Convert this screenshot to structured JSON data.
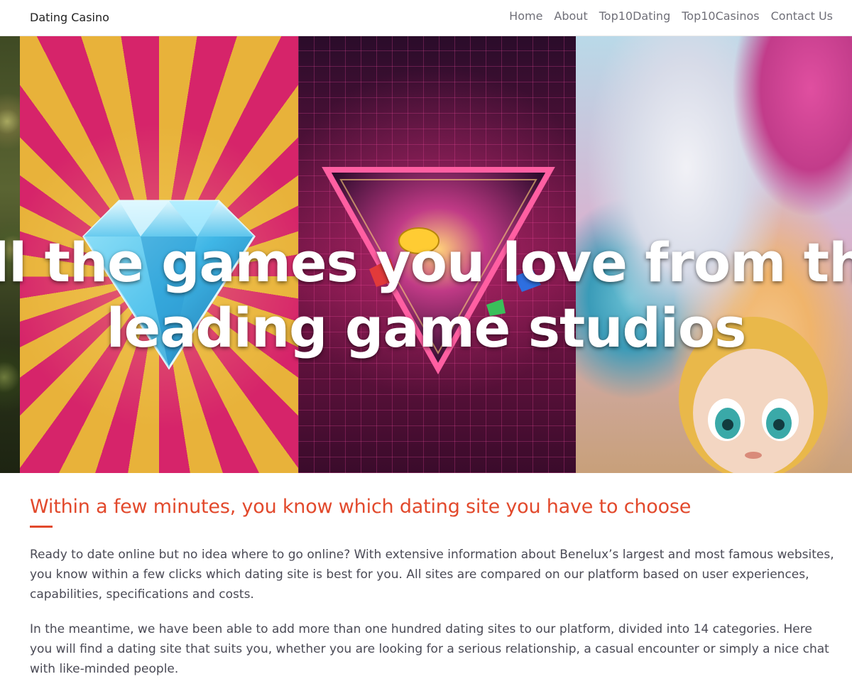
{
  "navbar": {
    "brand": "Dating Casino",
    "links": [
      "Home",
      "About",
      "Top10Dating",
      "Top10Casinos",
      "Contact Us"
    ]
  },
  "hero": {
    "title_line_1": "All the games you love from the",
    "title_line_2": "leading game studios",
    "tiles": [
      "jungle-slot-tile",
      "diamond-sunburst-slot-tile",
      "neon-gem-triangle-slot-tile",
      "candy-doll-slot-tile"
    ]
  },
  "intro": {
    "heading": "Within a few minutes, you know which dating site you have to choose",
    "accent_color": "#e2492c",
    "paragraphs": [
      "Ready to date online but no idea where to go online? With extensive information about Benelux’s largest and most famous websites, you know within a few clicks which dating site is best for you. All sites are compared on our platform based on user experiences, capabilities, specifications and costs.",
      "In the meantime, we have been able to add more than one hundred dating sites to our platform, divided into 14 categories. Here you will find a dating site that suits you, whether you are looking for a serious relationship, a casual encounter or simply a nice chat with like-minded people."
    ]
  }
}
